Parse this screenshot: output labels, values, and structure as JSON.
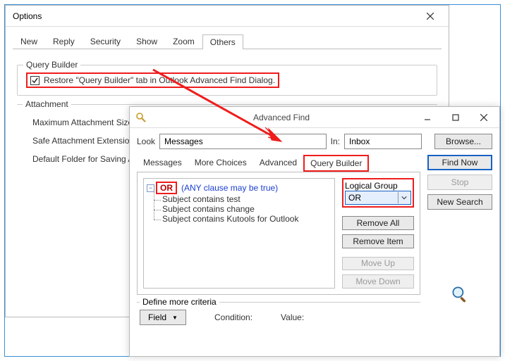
{
  "options": {
    "title": "Options",
    "tabs": [
      "New",
      "Reply",
      "Security",
      "Show",
      "Zoom",
      "Others"
    ],
    "active_tab_index": 5,
    "query_builder": {
      "legend": "Query Builder",
      "checkbox_label": "Restore \"Query Builder\" tab in Outlook Advanced Find Dialog.",
      "checked": true
    },
    "attachment": {
      "legend": "Attachment",
      "rows": [
        "Maximum Attachment Size",
        "Safe Attachment Extension",
        "Default Folder for Saving A"
      ]
    }
  },
  "advanced_find": {
    "title": "Advanced Find",
    "look_label": "Look",
    "look_value": "Messages",
    "in_label": "In:",
    "in_value": "Inbox",
    "browse_label": "Browse...",
    "tabs": [
      "Messages",
      "More Choices",
      "Advanced",
      "Query Builder"
    ],
    "active_tab_index": 3,
    "buttons": {
      "find_now": "Find Now",
      "stop": "Stop",
      "new_search": "New Search"
    },
    "tree": {
      "root_operator": "OR",
      "root_hint": "(ANY clause may be true)",
      "items": [
        "Subject contains test",
        "Subject contains change",
        "Subject contains Kutools for Outlook"
      ]
    },
    "logical_group": {
      "label": "Logical Group",
      "value": "OR"
    },
    "side_buttons": {
      "remove_all": "Remove All",
      "remove_item": "Remove Item",
      "move_up": "Move Up",
      "move_down": "Move Down"
    },
    "define": {
      "legend": "Define more criteria",
      "field_button": "Field",
      "condition_label": "Condition:",
      "value_label": "Value:"
    }
  }
}
